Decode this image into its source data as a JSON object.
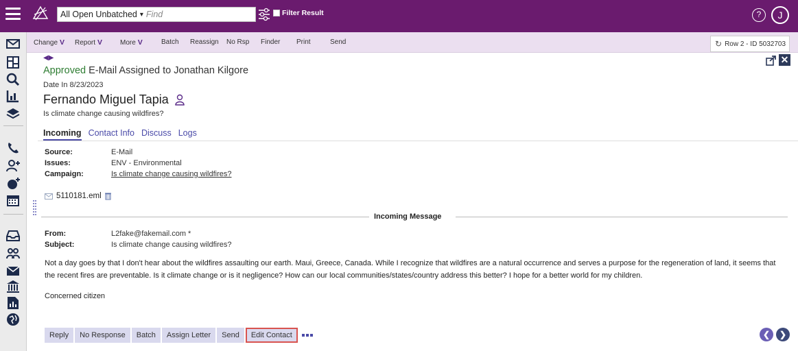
{
  "topbar": {
    "queue": "All Open Unbatched",
    "find_placeholder": "Find",
    "filter_label": "Filter Result",
    "help_symbol": "?",
    "user_initial": "J"
  },
  "toolbar": {
    "items": [
      {
        "label": "Change",
        "has_caret": true
      },
      {
        "label": "Report",
        "has_caret": true
      },
      {
        "label": "More",
        "has_caret": true
      },
      {
        "label": "Batch"
      },
      {
        "label": "Reassign"
      },
      {
        "label": "No Rsp"
      },
      {
        "label": "Finder"
      },
      {
        "label": "Print"
      },
      {
        "label": "Send"
      }
    ],
    "caret_glyph": "V",
    "row_indicator": "Row 2 - ID 5032703"
  },
  "record": {
    "status_word": "Approved",
    "status_rest": " E-Mail Assigned to Jonathan Kilgore",
    "date_in": "Date In 8/23/2023",
    "person_name": "Fernando Miguel Tapia",
    "subject": "Is climate change causing wildfires?",
    "tabs": [
      "Incoming",
      "Contact Info",
      "Discuss",
      "Logs"
    ]
  },
  "details": [
    {
      "label": "Source:",
      "value": "E-Mail",
      "link": false
    },
    {
      "label": "Issues:",
      "value": "ENV - Environmental",
      "link": false
    },
    {
      "label": "Campaign:",
      "value": "Is climate change causing wildfires?",
      "link": true
    }
  ],
  "attachment": "5110181.eml",
  "message": {
    "section_title": "Incoming Message",
    "from_label": "From:",
    "from_value": "L2fake@fakemail.com *",
    "subject_label": "Subject:",
    "subject_value": "Is climate change causing wildfires?",
    "body": "Not a day goes by that I don't hear about the wildfires assaulting our earth. Maui, Greece, Canada. While I recognize that wildfires are a natural occurrence and serves a purpose for the regeneration of land, it seems that the recent fires are preventable. Is it climate change or is it negligence? How can our local communities/states/country address this better? I hope for a better world for my children.",
    "signature": "Concerned citizen"
  },
  "actions": [
    "Reply",
    "No Response",
    "Batch",
    "Assign Letter",
    "Send",
    "Edit Contact"
  ],
  "nav": {
    "prev": "❮",
    "next": "❯"
  },
  "colors": {
    "topbar": "#6a1b6e",
    "toolbar": "#ebdff0",
    "accent": "#5a2a88",
    "approved": "#2e7d32",
    "highlight_border": "#d9534f"
  }
}
